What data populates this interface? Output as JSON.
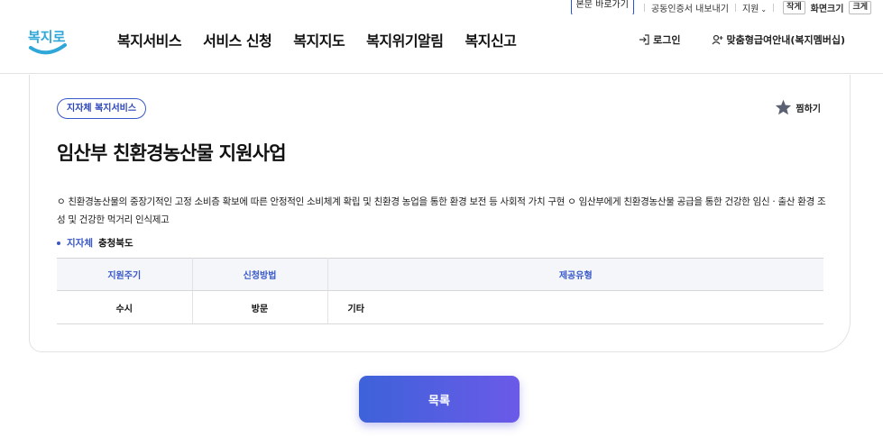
{
  "util_bar": {
    "skip_link": "본문 바로가기",
    "cert_export": "공동인증서 내보내기",
    "support": "지원",
    "zoom_small": "작게",
    "zoom_label": "화면크기",
    "zoom_large": "크게"
  },
  "header": {
    "logo_text": "복지로",
    "nav": [
      "복지서비스",
      "서비스 신청",
      "복지지도",
      "복지위기알림",
      "복지신고"
    ],
    "login": "로그인",
    "membership": "맞춤형급여안내(복지멤버십)"
  },
  "service": {
    "badge": "지자체 복지서비스",
    "favorite": "찜하기",
    "title": "임산부 친환경농산물 지원사업",
    "description": "ㅇ 친환경농산물의 중장기적인 고정 소비층 확보에 따른 안정적인 소비체계 확립 및 친환경 농업을 통한 환경 보전 등 사회적 가치 구현 ㅇ 임산부에게 친환경농산물 공급을 통한 건강한 임신 · 출산 환경 조성 및 건강한 먹거리 인식제고",
    "agency_label": "지자체",
    "agency_value": "충청북도",
    "table": {
      "headers": [
        "지원주기",
        "신청방법",
        "제공유형"
      ],
      "row": [
        "수시",
        "방문",
        "기타"
      ]
    }
  },
  "list_button": "목록",
  "colors": {
    "accent": "#3a59c7",
    "button_start": "#3d62d9",
    "button_end": "#6b5ae8"
  }
}
